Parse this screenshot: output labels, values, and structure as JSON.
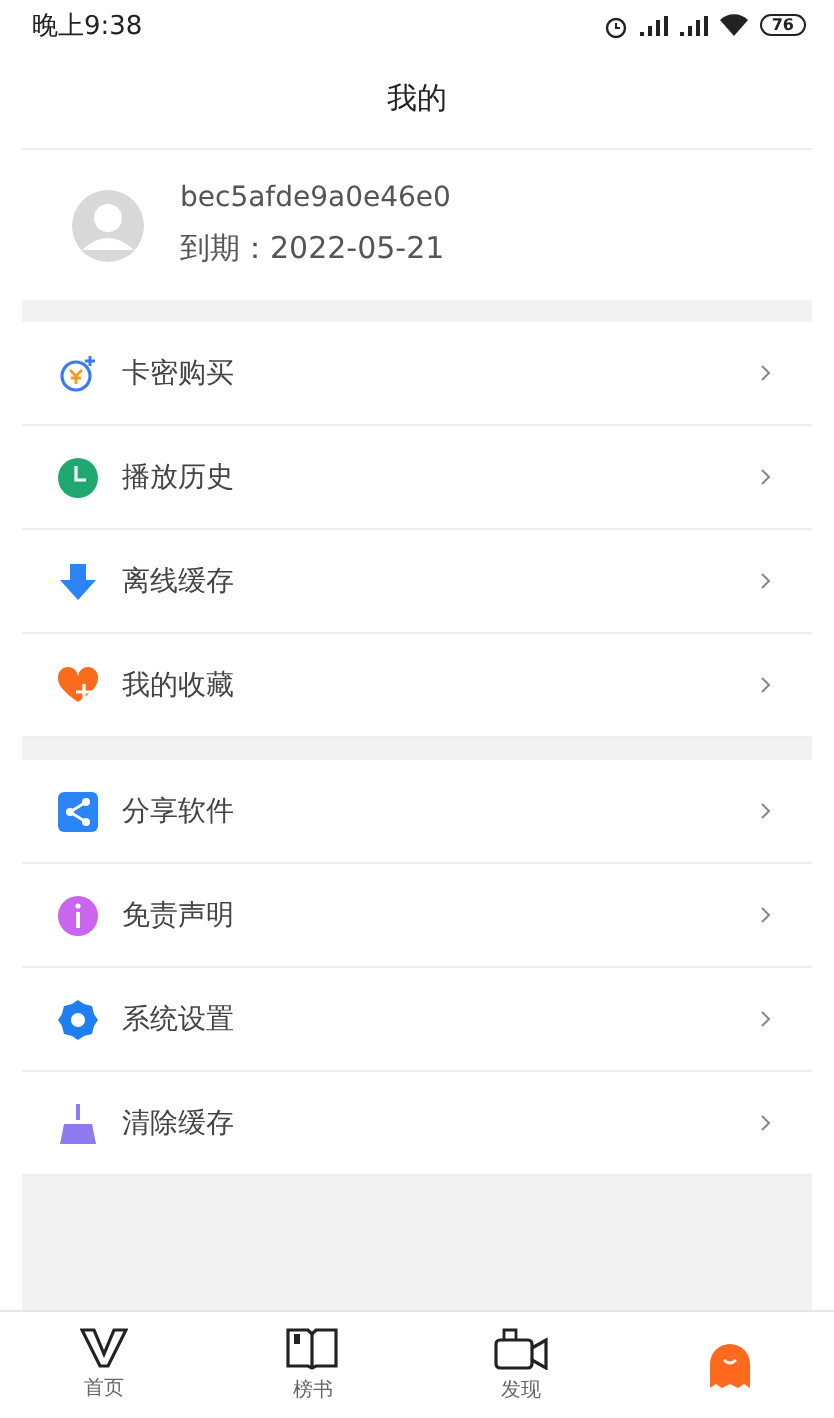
{
  "status_bar": {
    "time": "晚上9:38",
    "battery": "76"
  },
  "title": "我的",
  "profile": {
    "name": "bec5afde9a0e46e0",
    "expiry": "到期：2022-05-21"
  },
  "menu_groups": [
    {
      "items": [
        {
          "label": "卡密购买",
          "kind": "coin"
        },
        {
          "label": "播放历史",
          "kind": "clock"
        },
        {
          "label": "离线缓存",
          "kind": "download"
        },
        {
          "label": "我的收藏",
          "kind": "heart"
        }
      ]
    },
    {
      "items": [
        {
          "label": "分享软件",
          "kind": "share"
        },
        {
          "label": "免责声明",
          "kind": "info"
        },
        {
          "label": "系统设置",
          "kind": "gear"
        },
        {
          "label": "清除缓存",
          "kind": "broom"
        }
      ]
    }
  ],
  "tabs": [
    {
      "label": "首页",
      "kind": "home",
      "selected": false
    },
    {
      "label": "榜书",
      "kind": "book",
      "selected": false
    },
    {
      "label": "发现",
      "kind": "video",
      "selected": false
    },
    {
      "kind": "me",
      "selected": true
    }
  ]
}
